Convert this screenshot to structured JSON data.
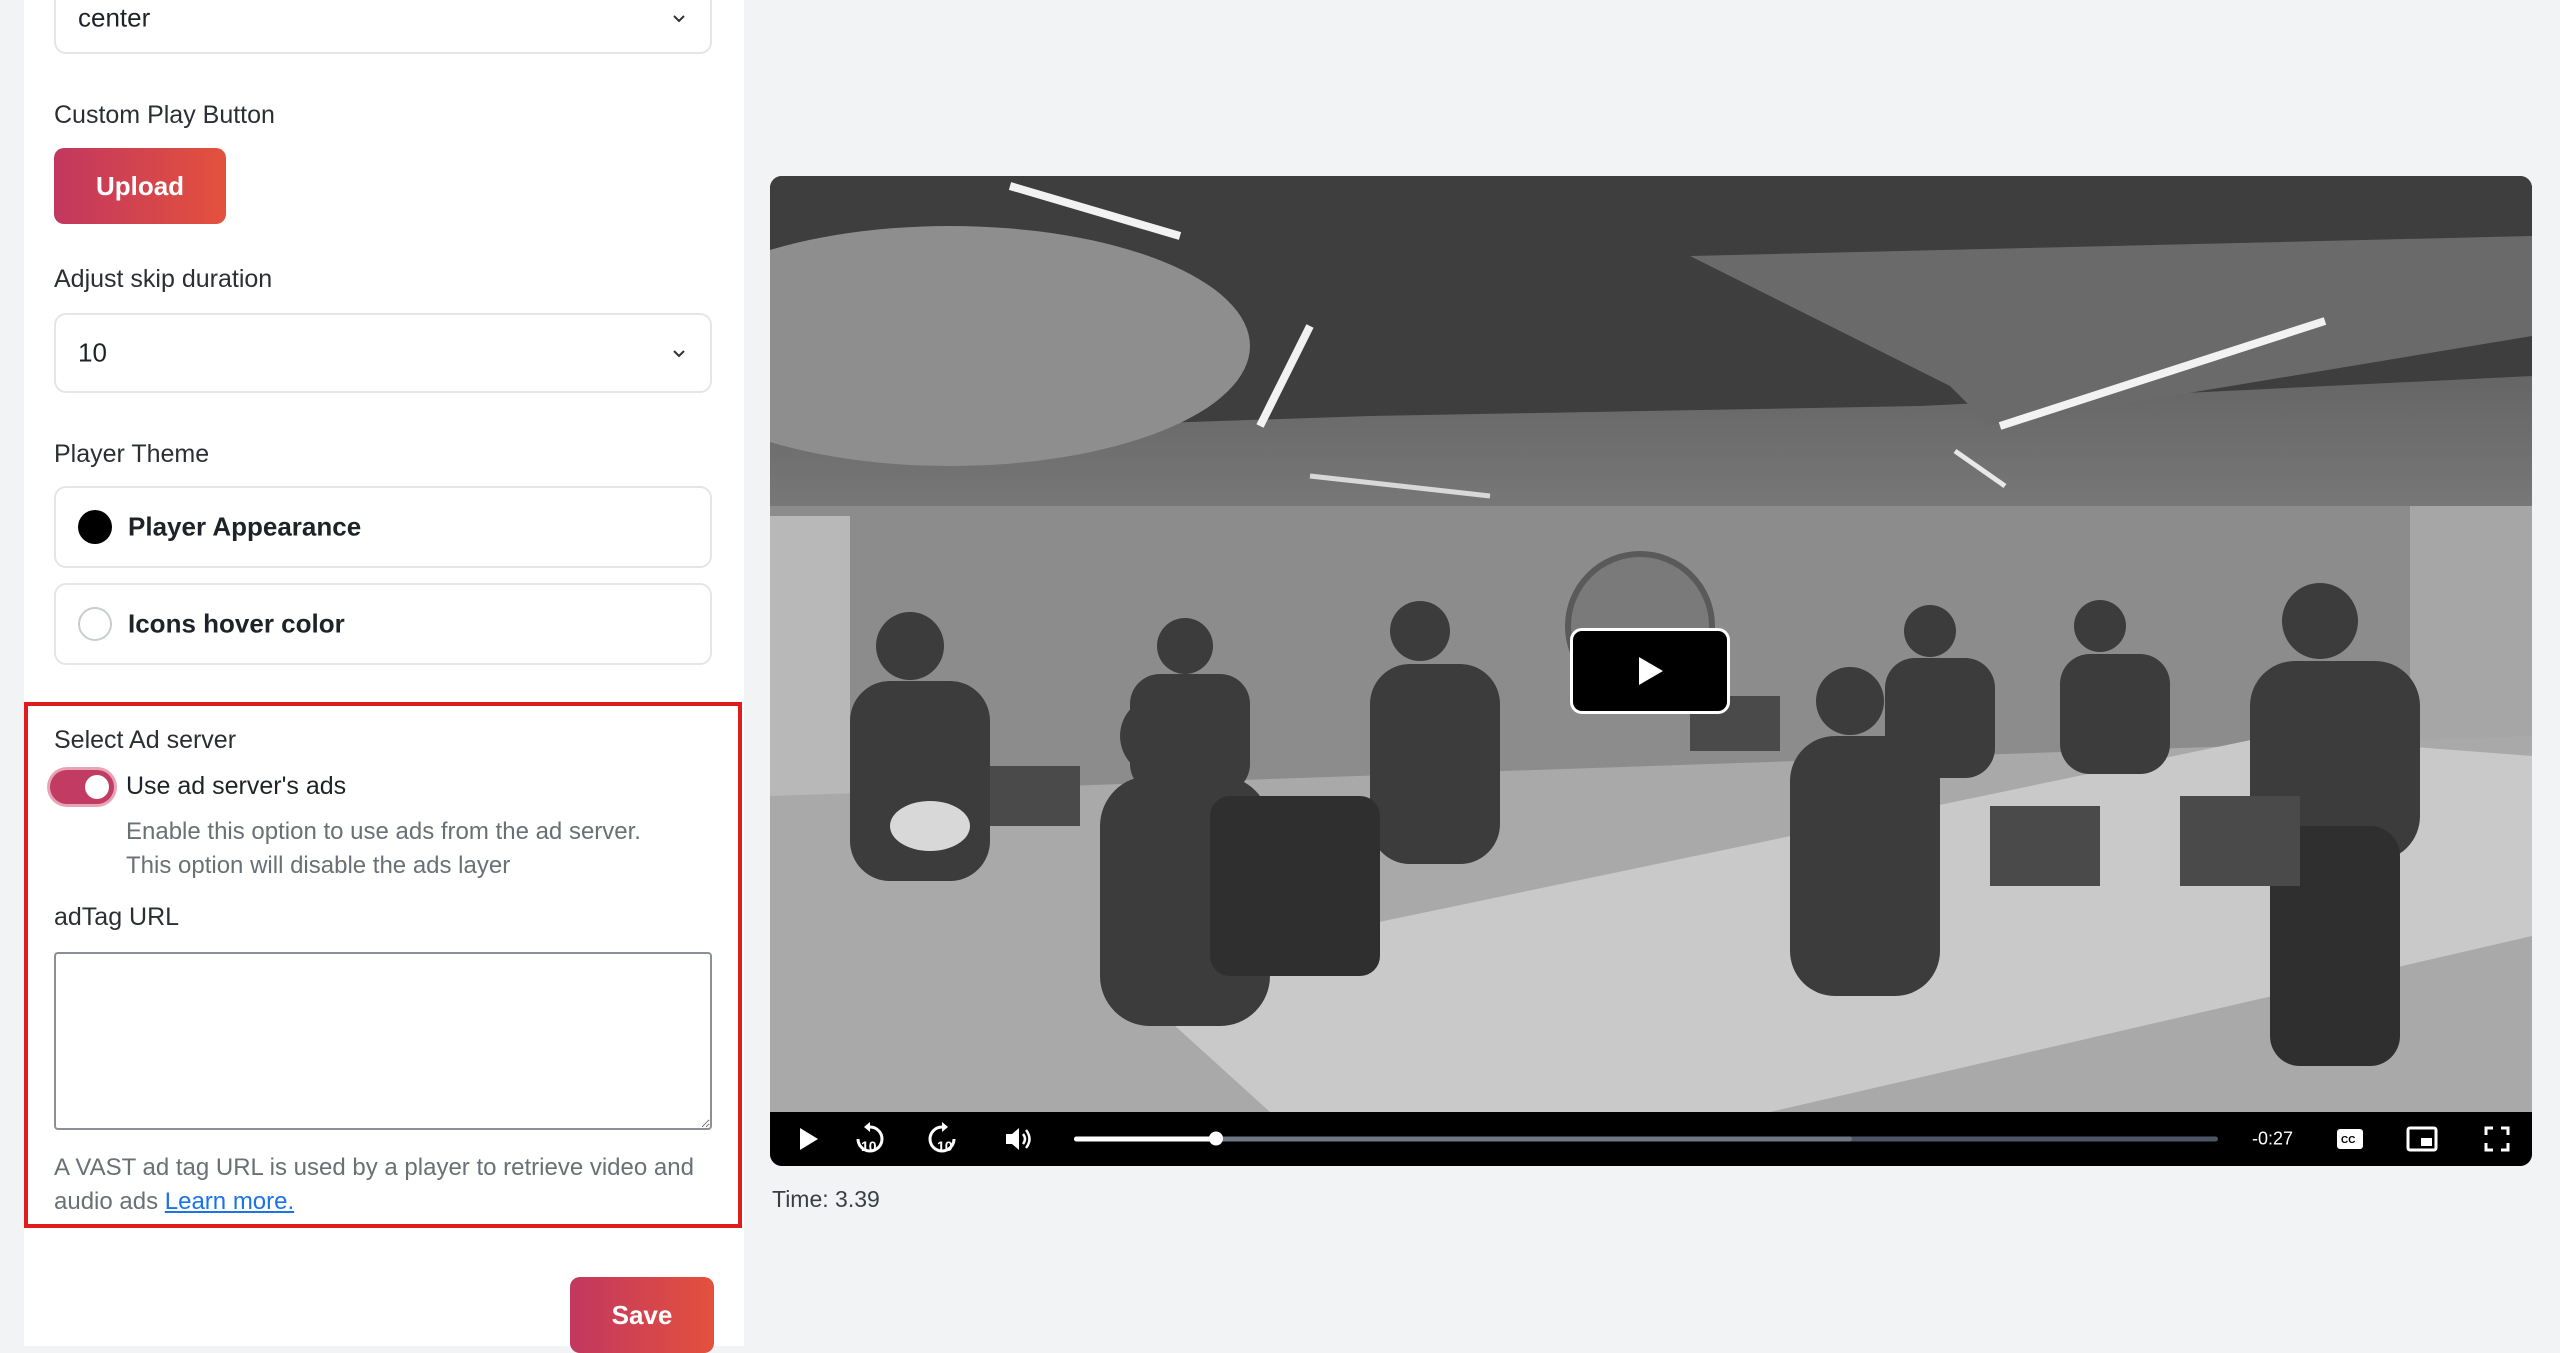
{
  "settings": {
    "position_select_value": "center",
    "custom_play_button_label": "Custom Play Button",
    "upload_button": "Upload",
    "skip_duration_label": "Adjust skip duration",
    "skip_duration_value": "10",
    "player_theme_label": "Player Theme",
    "theme_options": [
      {
        "label": "Player Appearance",
        "color": "#000000"
      },
      {
        "label": "Icons hover color",
        "color": "#ffffff"
      }
    ],
    "ad_server": {
      "section_label": "Select Ad server",
      "toggle_label": "Use ad server's ads",
      "toggle_on": true,
      "help_line1": "Enable this option to use ads from the ad server.",
      "help_line2": "This option will disable the ads layer",
      "adtag_label": "adTag URL",
      "adtag_value": "",
      "vast_help": "A VAST ad tag URL is used by a player to retrieve video and audio ads",
      "learn_more": "Learn more."
    },
    "save_button": "Save"
  },
  "player": {
    "remaining_time": "-0:27",
    "progress_fraction": 0.124,
    "buffered_fraction": 0.68,
    "time_readout": "Time: 3.39"
  },
  "colors": {
    "accent_start": "#c2375f",
    "accent_end": "#e3513d",
    "highlight_border": "#e01b1b",
    "link": "#1a73e8"
  }
}
